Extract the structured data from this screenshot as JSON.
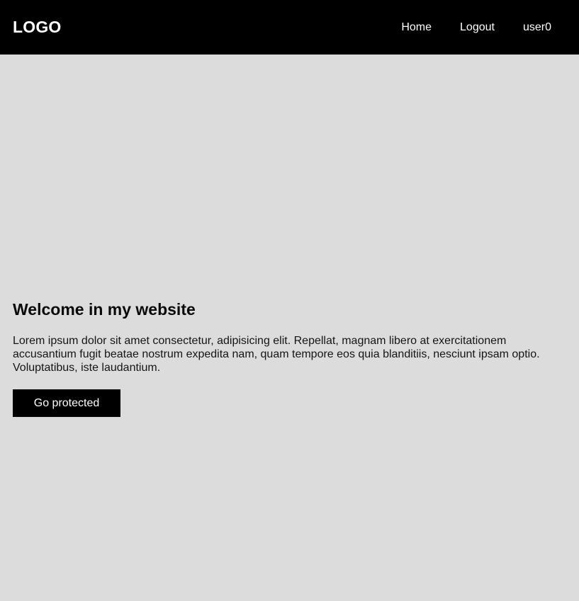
{
  "header": {
    "logo": "LOGO",
    "nav": [
      {
        "label": "Home"
      },
      {
        "label": "Logout"
      },
      {
        "label": "user0"
      }
    ]
  },
  "hero": {
    "title": "Welcome in my website",
    "text": "Lorem ipsum dolor sit amet consectetur, adipisicing elit. Repellat, magnam libero at exercitationem accusantium fugit beatae nostrum expedita nam, quam tempore eos quia blanditiis, nesciunt ipsam optio. Voluptatibus, iste laudantium.",
    "button_label": "Go protected"
  },
  "colors": {
    "header_bg": "#000000",
    "page_bg": "#dcdcdc",
    "button_bg": "#000000",
    "text_light": "#ffffff"
  }
}
